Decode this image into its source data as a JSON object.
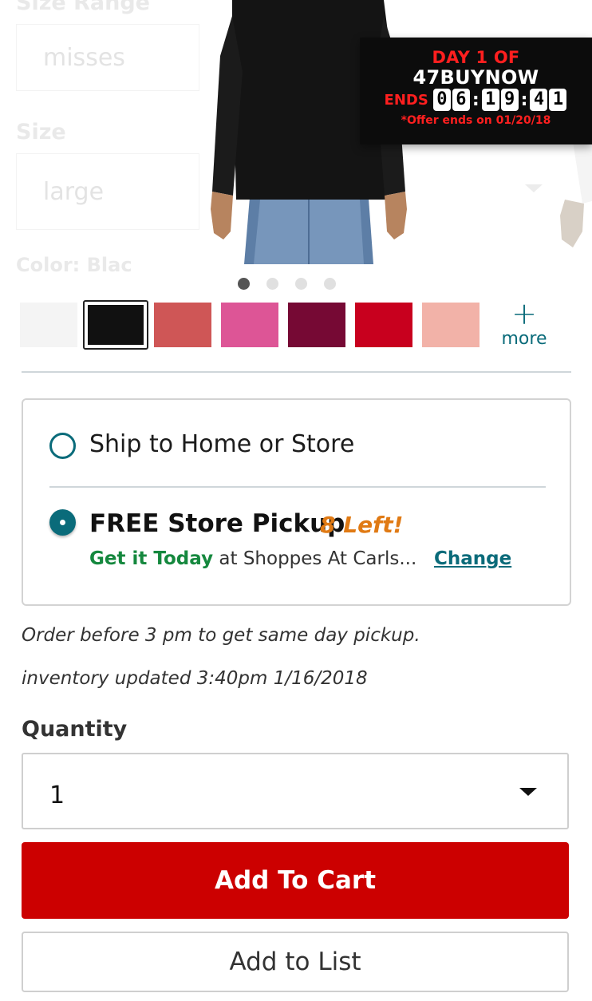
{
  "ghost": {
    "size_range_label": "Size Range",
    "size_range_value": "misses",
    "size_label": "Size",
    "size_value": "large",
    "color_label": "Color: Blac"
  },
  "promo": {
    "day_text": "DAY 1 OF",
    "code_text": "47BUYNOW",
    "ends_label": "ENDS",
    "timer_digits": [
      "0",
      "6",
      "1",
      "9",
      "4",
      "1"
    ],
    "offer_note": "*Offer ends on 01/20/18"
  },
  "carousel": {
    "total": 4,
    "active": 1
  },
  "swatches": {
    "colors": [
      "#f4f4f4",
      "#111111",
      "#cf5656",
      "#dd5596",
      "#760934",
      "#c8001e",
      "#f2b2a8"
    ],
    "selected_index": 1,
    "more_symbol": "+",
    "more_label": "more"
  },
  "fulfillment": {
    "ship_label": "Ship to Home or Store",
    "pickup_label": "FREE Store Pickup",
    "stock_badge": "8 Left!",
    "today_text": "Get it Today",
    "store_text": "at Shoppes At Carls...",
    "change_label": "Change",
    "accent_color": "#0a6b7a"
  },
  "notes": {
    "order_before": "Order before 3 pm to get same day pickup.",
    "inventory": "inventory updated 3:40pm 1/16/2018"
  },
  "quantity": {
    "label": "Quantity",
    "value": "1"
  },
  "buttons": {
    "add_to_cart": "Add To Cart",
    "add_to_list": "Add to List",
    "cart_color": "#cc0000"
  }
}
